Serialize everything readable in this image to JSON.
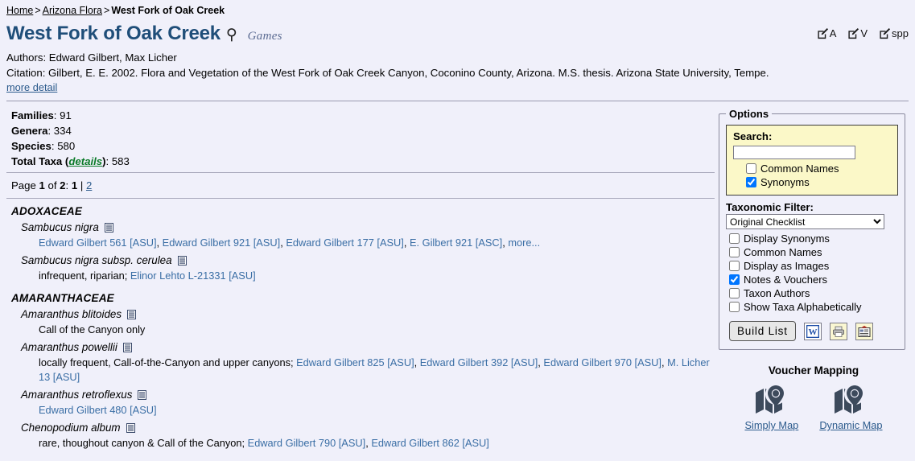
{
  "breadcrumb": {
    "home": "Home",
    "sep1": ">",
    "flora": "Arizona Flora",
    "sep2": ">",
    "current": "West Fork of Oak Creek"
  },
  "header": {
    "title": "West Fork of Oak Creek",
    "key_glyph": "⚲",
    "games_logo": "Games",
    "authors": "Authors: Edward Gilbert, Max Licher",
    "citation": "Citation: Gilbert, E. E. 2002. Flora and Vegetation of the West Fork of Oak Creek Canyon, Coconino County, Arizona. M.S. thesis. Arizona State University, Tempe.",
    "more_detail": "more detail",
    "icons": [
      {
        "name": "edit-admin",
        "label": "A"
      },
      {
        "name": "edit-vouchers",
        "label": "V"
      },
      {
        "name": "edit-species",
        "label": "spp"
      }
    ]
  },
  "stats": {
    "families_label": "Families",
    "families_value": "91",
    "genera_label": "Genera",
    "genera_value": "334",
    "species_label": "Species",
    "species_value": "580",
    "total_label": "Total Taxa",
    "total_details_link": "details",
    "total_value": "583"
  },
  "paging": {
    "prefix": "Page",
    "current": "1",
    "of": "of",
    "total": "2",
    "colon": ":",
    "page1": "1",
    "divider": "|",
    "page2": "2"
  },
  "options": {
    "legend": "Options",
    "search_label": "Search:",
    "search_value": "",
    "search_placeholder": "",
    "search_checkboxes": [
      {
        "label": "Common Names",
        "checked": false,
        "name": "search-common-names"
      },
      {
        "label": "Synonyms",
        "checked": true,
        "name": "search-synonyms"
      }
    ],
    "filter_label": "Taxonomic Filter:",
    "filter_selected": "Original Checklist",
    "filter_options": [
      "Original Checklist"
    ],
    "display_checkboxes": [
      {
        "label": "Display Synonyms",
        "checked": false,
        "name": "display-synonyms"
      },
      {
        "label": "Common Names",
        "checked": false,
        "name": "display-common-names"
      },
      {
        "label": "Display as Images",
        "checked": false,
        "name": "display-as-images"
      },
      {
        "label": "Notes & Vouchers",
        "checked": true,
        "name": "notes-and-vouchers"
      },
      {
        "label": "Taxon Authors",
        "checked": false,
        "name": "taxon-authors"
      },
      {
        "label": "Show Taxa Alphabetically",
        "checked": false,
        "name": "show-taxa-alphabetically"
      }
    ],
    "build_button": "Build List",
    "export_icons": [
      {
        "name": "word-export-icon",
        "glyph": "W"
      },
      {
        "name": "print-icon",
        "glyph": "print"
      },
      {
        "name": "spreadsheet-export-icon",
        "glyph": "sheet"
      }
    ]
  },
  "voucher": {
    "title": "Voucher Mapping",
    "maps": [
      {
        "label": "Simply Map",
        "name": "simply-map"
      },
      {
        "label": "Dynamic Map",
        "name": "dynamic-map"
      }
    ]
  },
  "taxa": [
    {
      "family": "ADOXACEAE",
      "items": [
        {
          "name": "Sambucus nigra",
          "note": "",
          "vouchers": [
            "Edward Gilbert 561 [ASU]",
            "Edward Gilbert 921 [ASU]",
            "Edward Gilbert 177 [ASU]",
            "E. Gilbert 921 [ASC]",
            "more..."
          ]
        },
        {
          "name": "Sambucus nigra subsp. cerulea",
          "note": "infrequent, riparian;",
          "vouchers": [
            "Elinor Lehto L-21331 [ASU]"
          ]
        }
      ]
    },
    {
      "family": "AMARANTHACEAE",
      "items": [
        {
          "name": "Amaranthus blitoides",
          "note": "Call of the Canyon only",
          "vouchers": []
        },
        {
          "name": "Amaranthus powellii",
          "note": "locally frequent, Call-of-the-Canyon and upper canyons;",
          "vouchers": [
            "Edward Gilbert 825 [ASU]",
            "Edward Gilbert 392 [ASU]",
            "Edward Gilbert 970 [ASU]",
            "M. Licher 13 [ASU]"
          ]
        },
        {
          "name": "Amaranthus retroflexus",
          "note": "",
          "vouchers": [
            "Edward Gilbert 480 [ASU]"
          ]
        },
        {
          "name": "Chenopodium album",
          "note": "rare, thoughout canyon & Call of the Canyon;",
          "vouchers": [
            "Edward Gilbert 790 [ASU]",
            "Edward Gilbert 862 [ASU]"
          ]
        }
      ]
    }
  ],
  "colors": {
    "page_background": "#f0f0fa",
    "title": "#1f4e79",
    "link": "#2b5a8c",
    "voucher_link": "#3a6ea5",
    "details_link": "#0a7a28",
    "search_panel": "#fbf8c8",
    "map_icon": "#3d4a5c"
  }
}
